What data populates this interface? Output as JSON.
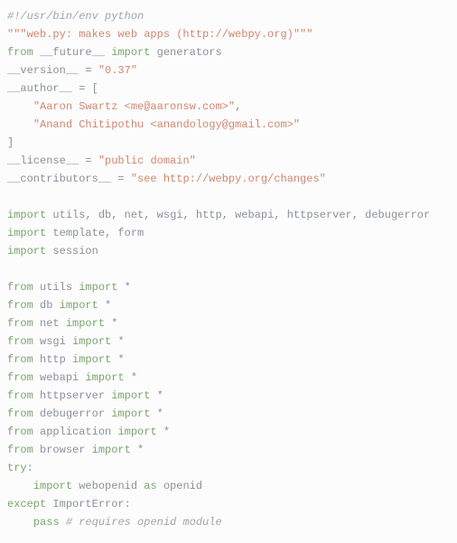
{
  "code": {
    "lines": [
      {
        "segments": [
          {
            "cls": "tok-comment",
            "t": "#!/usr/bin/env python"
          }
        ]
      },
      {
        "segments": [
          {
            "cls": "tok-docstr",
            "t": "\"\"\"web.py: makes web apps (http://webpy.org)\"\"\""
          }
        ]
      },
      {
        "segments": [
          {
            "cls": "tok-keyword",
            "t": "from"
          },
          {
            "cls": "tok-readable",
            "t": " __future__ "
          },
          {
            "cls": "tok-keyword",
            "t": "import"
          },
          {
            "cls": "tok-readable",
            "t": " generators"
          }
        ]
      },
      {
        "segments": [
          {
            "cls": "tok-readable",
            "t": "__version__ "
          },
          {
            "cls": "tok-op",
            "t": "="
          },
          {
            "cls": "tok-readable",
            "t": " "
          },
          {
            "cls": "tok-string",
            "t": "\"0.37\""
          }
        ]
      },
      {
        "segments": [
          {
            "cls": "tok-readable",
            "t": "__author__ "
          },
          {
            "cls": "tok-op",
            "t": "="
          },
          {
            "cls": "tok-readable",
            "t": " "
          },
          {
            "cls": "tok-bracket",
            "t": "["
          }
        ]
      },
      {
        "segments": [
          {
            "cls": "tok-readable",
            "t": "    "
          },
          {
            "cls": "tok-string",
            "t": "\"Aaron Swartz <me@aaronsw.com>\""
          },
          {
            "cls": "tok-punct",
            "t": ","
          }
        ]
      },
      {
        "segments": [
          {
            "cls": "tok-readable",
            "t": "    "
          },
          {
            "cls": "tok-string",
            "t": "\"Anand Chitipothu <anandology@gmail.com>\""
          }
        ]
      },
      {
        "segments": [
          {
            "cls": "tok-bracket",
            "t": "]"
          }
        ]
      },
      {
        "segments": [
          {
            "cls": "tok-readable",
            "t": "__license__ "
          },
          {
            "cls": "tok-op",
            "t": "="
          },
          {
            "cls": "tok-readable",
            "t": " "
          },
          {
            "cls": "tok-string",
            "t": "\"public domain\""
          }
        ]
      },
      {
        "segments": [
          {
            "cls": "tok-readable",
            "t": "__contributors__ "
          },
          {
            "cls": "tok-op",
            "t": "="
          },
          {
            "cls": "tok-readable",
            "t": " "
          },
          {
            "cls": "tok-string",
            "t": "\"see http://webpy.org/changes\""
          }
        ]
      },
      {
        "segments": [
          {
            "cls": "tok-readable",
            "t": ""
          }
        ]
      },
      {
        "segments": [
          {
            "cls": "tok-keyword",
            "t": "import"
          },
          {
            "cls": "tok-readable",
            "t": " utils"
          },
          {
            "cls": "tok-punct",
            "t": ","
          },
          {
            "cls": "tok-readable",
            "t": " db"
          },
          {
            "cls": "tok-punct",
            "t": ","
          },
          {
            "cls": "tok-readable",
            "t": " net"
          },
          {
            "cls": "tok-punct",
            "t": ","
          },
          {
            "cls": "tok-readable",
            "t": " wsgi"
          },
          {
            "cls": "tok-punct",
            "t": ","
          },
          {
            "cls": "tok-readable",
            "t": " http"
          },
          {
            "cls": "tok-punct",
            "t": ","
          },
          {
            "cls": "tok-readable",
            "t": " webapi"
          },
          {
            "cls": "tok-punct",
            "t": ","
          },
          {
            "cls": "tok-readable",
            "t": " httpserver"
          },
          {
            "cls": "tok-punct",
            "t": ","
          },
          {
            "cls": "tok-readable",
            "t": " debugerror"
          }
        ]
      },
      {
        "segments": [
          {
            "cls": "tok-keyword",
            "t": "import"
          },
          {
            "cls": "tok-readable",
            "t": " template"
          },
          {
            "cls": "tok-punct",
            "t": ","
          },
          {
            "cls": "tok-readable",
            "t": " form"
          }
        ]
      },
      {
        "segments": [
          {
            "cls": "tok-keyword",
            "t": "import"
          },
          {
            "cls": "tok-readable",
            "t": " session"
          }
        ]
      },
      {
        "segments": [
          {
            "cls": "tok-readable",
            "t": ""
          }
        ]
      },
      {
        "segments": [
          {
            "cls": "tok-keyword",
            "t": "from"
          },
          {
            "cls": "tok-readable",
            "t": " utils "
          },
          {
            "cls": "tok-keyword",
            "t": "import"
          },
          {
            "cls": "tok-readable",
            "t": " "
          },
          {
            "cls": "tok-op",
            "t": "*"
          }
        ]
      },
      {
        "segments": [
          {
            "cls": "tok-keyword",
            "t": "from"
          },
          {
            "cls": "tok-readable",
            "t": " db "
          },
          {
            "cls": "tok-keyword",
            "t": "import"
          },
          {
            "cls": "tok-readable",
            "t": " "
          },
          {
            "cls": "tok-op",
            "t": "*"
          }
        ]
      },
      {
        "segments": [
          {
            "cls": "tok-keyword",
            "t": "from"
          },
          {
            "cls": "tok-readable",
            "t": " net "
          },
          {
            "cls": "tok-keyword",
            "t": "import"
          },
          {
            "cls": "tok-readable",
            "t": " "
          },
          {
            "cls": "tok-op",
            "t": "*"
          }
        ]
      },
      {
        "segments": [
          {
            "cls": "tok-keyword",
            "t": "from"
          },
          {
            "cls": "tok-readable",
            "t": " wsgi "
          },
          {
            "cls": "tok-keyword",
            "t": "import"
          },
          {
            "cls": "tok-readable",
            "t": " "
          },
          {
            "cls": "tok-op",
            "t": "*"
          }
        ]
      },
      {
        "segments": [
          {
            "cls": "tok-keyword",
            "t": "from"
          },
          {
            "cls": "tok-readable",
            "t": " http "
          },
          {
            "cls": "tok-keyword",
            "t": "import"
          },
          {
            "cls": "tok-readable",
            "t": " "
          },
          {
            "cls": "tok-op",
            "t": "*"
          }
        ]
      },
      {
        "segments": [
          {
            "cls": "tok-keyword",
            "t": "from"
          },
          {
            "cls": "tok-readable",
            "t": " webapi "
          },
          {
            "cls": "tok-keyword",
            "t": "import"
          },
          {
            "cls": "tok-readable",
            "t": " "
          },
          {
            "cls": "tok-op",
            "t": "*"
          }
        ]
      },
      {
        "segments": [
          {
            "cls": "tok-keyword",
            "t": "from"
          },
          {
            "cls": "tok-readable",
            "t": " httpserver "
          },
          {
            "cls": "tok-keyword",
            "t": "import"
          },
          {
            "cls": "tok-readable",
            "t": " "
          },
          {
            "cls": "tok-op",
            "t": "*"
          }
        ]
      },
      {
        "segments": [
          {
            "cls": "tok-keyword",
            "t": "from"
          },
          {
            "cls": "tok-readable",
            "t": " debugerror "
          },
          {
            "cls": "tok-keyword",
            "t": "import"
          },
          {
            "cls": "tok-readable",
            "t": " "
          },
          {
            "cls": "tok-op",
            "t": "*"
          }
        ]
      },
      {
        "segments": [
          {
            "cls": "tok-keyword",
            "t": "from"
          },
          {
            "cls": "tok-readable",
            "t": " application "
          },
          {
            "cls": "tok-keyword",
            "t": "import"
          },
          {
            "cls": "tok-readable",
            "t": " "
          },
          {
            "cls": "tok-op",
            "t": "*"
          }
        ]
      },
      {
        "segments": [
          {
            "cls": "tok-keyword",
            "t": "from"
          },
          {
            "cls": "tok-readable",
            "t": " browser "
          },
          {
            "cls": "tok-keyword",
            "t": "import"
          },
          {
            "cls": "tok-readable",
            "t": " "
          },
          {
            "cls": "tok-op",
            "t": "*"
          }
        ]
      },
      {
        "segments": [
          {
            "cls": "tok-keyword",
            "t": "try"
          },
          {
            "cls": "tok-punct",
            "t": ":"
          }
        ]
      },
      {
        "segments": [
          {
            "cls": "tok-readable",
            "t": "    "
          },
          {
            "cls": "tok-keyword",
            "t": "import"
          },
          {
            "cls": "tok-readable",
            "t": " webopenid "
          },
          {
            "cls": "tok-keyword",
            "t": "as"
          },
          {
            "cls": "tok-readable",
            "t": " openid"
          }
        ]
      },
      {
        "segments": [
          {
            "cls": "tok-keyword",
            "t": "except"
          },
          {
            "cls": "tok-readable",
            "t": " ImportError"
          },
          {
            "cls": "tok-punct",
            "t": ":"
          }
        ]
      },
      {
        "segments": [
          {
            "cls": "tok-readable",
            "t": "    "
          },
          {
            "cls": "tok-keyword",
            "t": "pass"
          },
          {
            "cls": "tok-readable",
            "t": " "
          },
          {
            "cls": "tok-comment",
            "t": "# requires openid module"
          }
        ]
      }
    ]
  }
}
